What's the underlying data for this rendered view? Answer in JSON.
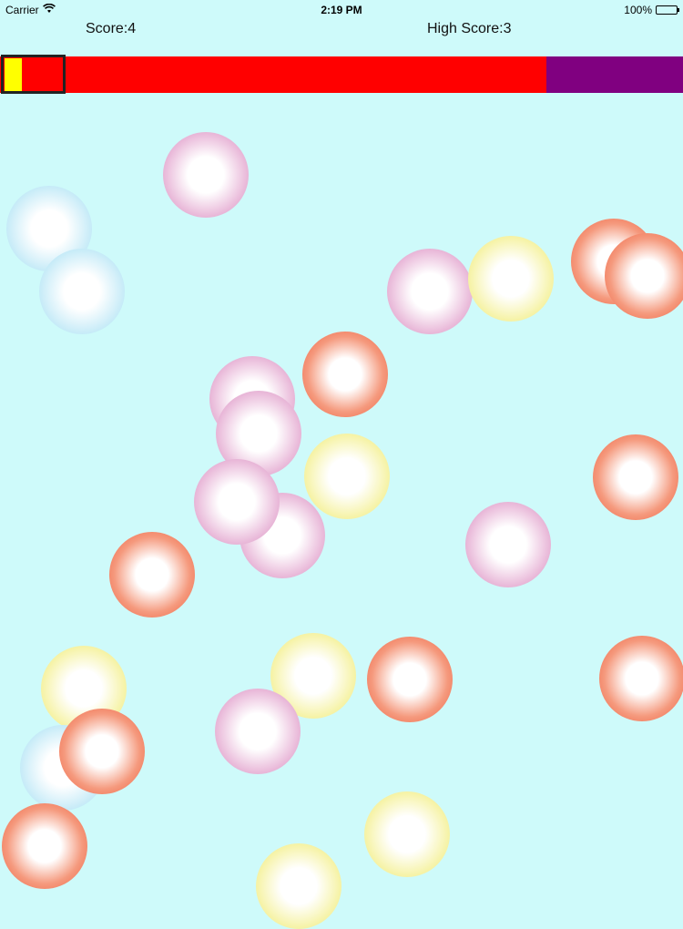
{
  "status_bar": {
    "carrier": "Carrier",
    "time": "2:19 PM",
    "battery": "100%"
  },
  "hud": {
    "score_label": "Score:4",
    "high_score_label": "High Score:3"
  },
  "timer": {
    "remaining_fraction": 0.8,
    "fill_color": "#ff0000",
    "remaining_color": "#800080",
    "target_color": "#ffff00"
  },
  "bubbles": [
    {
      "color": "pink"
    },
    {
      "color": "blue"
    },
    {
      "color": "blue"
    },
    {
      "color": "pink"
    },
    {
      "color": "yellow"
    },
    {
      "color": "orange"
    },
    {
      "color": "orange"
    },
    {
      "color": "pink"
    },
    {
      "color": "orange"
    },
    {
      "color": "pink"
    },
    {
      "color": "yellow"
    },
    {
      "color": "orange"
    },
    {
      "color": "pink"
    },
    {
      "color": "pink"
    },
    {
      "color": "pink"
    },
    {
      "color": "orange"
    },
    {
      "color": "yellow"
    },
    {
      "color": "orange"
    },
    {
      "color": "orange"
    },
    {
      "color": "yellow"
    },
    {
      "color": "pink"
    },
    {
      "color": "blue"
    },
    {
      "color": "orange"
    },
    {
      "color": "orange"
    },
    {
      "color": "yellow"
    },
    {
      "color": "yellow"
    }
  ]
}
